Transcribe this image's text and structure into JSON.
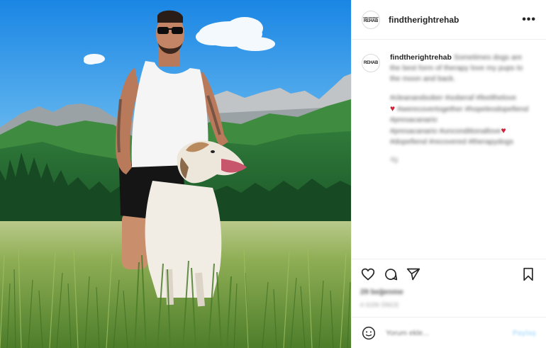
{
  "post": {
    "username": "findtherightrehab",
    "logo_text_top": "FIND THE RIGHT",
    "logo_text_bottom": "REHAB",
    "more_label": "•••"
  },
  "caption": {
    "username": "findtherightrehab",
    "text": "Sometimes dogs are the best form of therapy love my pups to the moon and back.",
    "tags_line1": "#cleanandsober #soberaf #feelthelove",
    "heart1": "♥",
    "tags_line2": "#werecovertogether #hopeleodopefiend #presacanario",
    "tags_line3": "#presacanario #unconditionallove",
    "heart2": "♥",
    "tags_line4": "#dopefiend #recovered #therapydogs",
    "time": "4g"
  },
  "actions": {
    "likes": "29 beğenme",
    "date": "4 GÜN ÖNCE"
  },
  "comment": {
    "placeholder": "Yorum ekle...",
    "post_label": "Paylaş"
  },
  "icons": {
    "like": "heart-icon",
    "comment": "comment-icon",
    "share": "share-icon",
    "save": "bookmark-icon",
    "emoji": "emoji-icon",
    "more": "more-icon"
  }
}
